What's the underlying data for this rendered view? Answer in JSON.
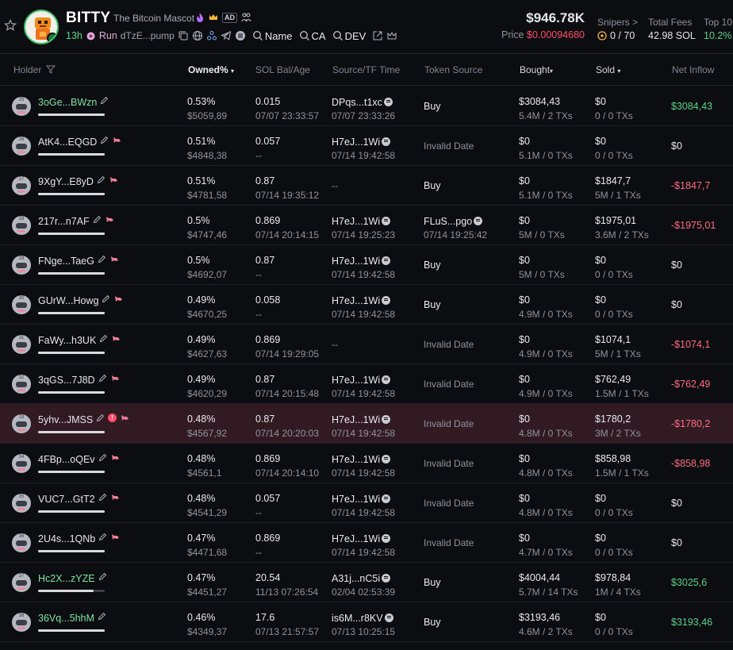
{
  "header": {
    "name": "BITTY",
    "full_name": "The Bitcoin Mascot",
    "badge_ad": "AD",
    "age": "13h",
    "run_label": "Run",
    "ca_short": "dTzE...pump",
    "search_name_label": "Name",
    "search_ca_label": "CA",
    "search_dev_label": "DEV",
    "market_cap": "$946.78K",
    "price_label": "Price",
    "price_value": "$0.00094680",
    "snipers_label": "Snipers >",
    "snipers_value": "0 / 70",
    "fees_label": "Total Fees",
    "fees_value": "42.98 SOL",
    "top10_label": "Top 10",
    "top10_value": "10.2%"
  },
  "columns": {
    "holder": "Holder",
    "owned": "Owned%",
    "sol_bal": "SOL Bal/Age",
    "source_tf": "Source/TF Time",
    "token_source": "Token Source",
    "bought": "Bought",
    "sold": "Sold",
    "net_inflow": "Net Inflow"
  },
  "colors": {
    "accent_green": "#59d38c",
    "accent_red": "#ff4d6a",
    "highlight_row": "#321a23"
  },
  "rows": [
    {
      "rank": "25",
      "holder": "3oGe...BWzn",
      "green": true,
      "fish": false,
      "warn": false,
      "owned_pct": "0.53%",
      "owned_usd": "$5059,89",
      "sol": "0.015",
      "age": "07/07 23:33:57",
      "src": "DPqs...t1xc",
      "src_time": "07/07 23:33:26",
      "tsrc": "Buy",
      "tsrc_time": "",
      "bought": "$3084,43",
      "bought_sub": "5.4M / 2 TXs",
      "sold": "$0",
      "sold_sub": "0 / 0 TXs",
      "net": "$3084,43",
      "net_cls": "pos",
      "fill": 1.0
    },
    {
      "rank": "26",
      "holder": "AtK4...EQGD",
      "green": false,
      "fish": true,
      "warn": false,
      "owned_pct": "0.51%",
      "owned_usd": "$4848,38",
      "sol": "0.057",
      "age": "--",
      "src": "H7eJ...1Wi",
      "src_time": "07/14 19:42:58",
      "tsrc": "Invalid Date",
      "tsrc_time": "",
      "bought": "$0",
      "bought_sub": "5.1M / 0 TXs",
      "sold": "$0",
      "sold_sub": "0 / 0 TXs",
      "net": "$0",
      "net_cls": "zero",
      "fill": 1.0
    },
    {
      "rank": "27",
      "holder": "9XgY...E8yD",
      "green": false,
      "fish": true,
      "warn": false,
      "owned_pct": "0.51%",
      "owned_usd": "$4781,58",
      "sol": "0.87",
      "age": "07/14 19:35:12",
      "src": "--",
      "src_time": "",
      "tsrc": "Buy",
      "tsrc_time": "",
      "bought": "$0",
      "bought_sub": "5.1M / 0 TXs",
      "sold": "$1847,7",
      "sold_sub": "5M / 1 TXs",
      "net": "-$1847,7",
      "net_cls": "neg",
      "fill": 1.0
    },
    {
      "rank": "28",
      "holder": "217r...n7AF",
      "green": false,
      "fish": true,
      "warn": false,
      "owned_pct": "0.5%",
      "owned_usd": "$4747,46",
      "sol": "0.869",
      "age": "07/14 20:14:15",
      "src": "H7eJ...1Wi",
      "src_time": "07/14 19:25:23",
      "tsrc": "FLuS...pgo",
      "tsrc_time": "07/14 19:25:42",
      "bought": "$0",
      "bought_sub": "5M / 0 TXs",
      "sold": "$1975,01",
      "sold_sub": "3.6M / 2 TXs",
      "net": "-$1975,01",
      "net_cls": "neg",
      "fill": 1.0
    },
    {
      "rank": "29",
      "holder": "FNge...TaeG",
      "green": false,
      "fish": true,
      "warn": false,
      "owned_pct": "0.5%",
      "owned_usd": "$4692,07",
      "sol": "0.87",
      "age": "--",
      "src": "H7eJ...1Wi",
      "src_time": "07/14 19:42:58",
      "tsrc": "Buy",
      "tsrc_time": "",
      "bought": "$0",
      "bought_sub": "5M / 0 TXs",
      "sold": "$0",
      "sold_sub": "0 / 0 TXs",
      "net": "$0",
      "net_cls": "zero",
      "fill": 1.0
    },
    {
      "rank": "30",
      "holder": "GUrW...Howg",
      "green": false,
      "fish": true,
      "warn": false,
      "owned_pct": "0.49%",
      "owned_usd": "$4670,25",
      "sol": "0.058",
      "age": "--",
      "src": "H7eJ...1Wi",
      "src_time": "07/14 19:42:58",
      "tsrc": "Buy",
      "tsrc_time": "",
      "bought": "$0",
      "bought_sub": "4.9M / 0 TXs",
      "sold": "$0",
      "sold_sub": "0 / 0 TXs",
      "net": "$0",
      "net_cls": "zero",
      "fill": 1.0
    },
    {
      "rank": "31",
      "holder": "FaWy...h3UK",
      "green": false,
      "fish": true,
      "warn": false,
      "owned_pct": "0.49%",
      "owned_usd": "$4627,63",
      "sol": "0.869",
      "age": "07/14 19:29:05",
      "src": "--",
      "src_time": "",
      "tsrc": "Invalid Date",
      "tsrc_time": "",
      "bought": "$0",
      "bought_sub": "4.9M / 0 TXs",
      "sold": "$1074,1",
      "sold_sub": "5M / 1 TXs",
      "net": "-$1074,1",
      "net_cls": "neg",
      "fill": 1.0
    },
    {
      "rank": "32",
      "holder": "3qGS...7J8D",
      "green": false,
      "fish": true,
      "warn": false,
      "owned_pct": "0.49%",
      "owned_usd": "$4620,29",
      "sol": "0.87",
      "age": "07/14 20:15:48",
      "src": "H7eJ...1Wi",
      "src_time": "07/14 19:42:58",
      "tsrc": "Invalid Date",
      "tsrc_time": "",
      "bought": "$0",
      "bought_sub": "4.9M / 0 TXs",
      "sold": "$762,49",
      "sold_sub": "1.5M / 1 TXs",
      "net": "-$762,49",
      "net_cls": "neg",
      "fill": 1.0
    },
    {
      "rank": "33",
      "holder": "5yhv...JMSS",
      "green": false,
      "fish": true,
      "warn": true,
      "owned_pct": "0.48%",
      "owned_usd": "$4567,92",
      "sol": "0.87",
      "age": "07/14 20:20:03",
      "src": "H7eJ...1Wi",
      "src_time": "07/14 19:42:58",
      "tsrc": "Invalid Date",
      "tsrc_time": "",
      "bought": "$0",
      "bought_sub": "4.8M / 0 TXs",
      "sold": "$1780,2",
      "sold_sub": "3M / 2 TXs",
      "net": "-$1780,2",
      "net_cls": "neg",
      "fill": 1.0,
      "highlight": true
    },
    {
      "rank": "34",
      "holder": "4FBp...oQEv",
      "green": false,
      "fish": true,
      "warn": false,
      "owned_pct": "0.48%",
      "owned_usd": "$4561,1",
      "sol": "0.869",
      "age": "07/14 20:14:10",
      "src": "H7eJ...1Wi",
      "src_time": "07/14 19:42:58",
      "tsrc": "Invalid Date",
      "tsrc_time": "",
      "bought": "$0",
      "bought_sub": "4.8M / 0 TXs",
      "sold": "$858,98",
      "sold_sub": "1.5M / 1 TXs",
      "net": "-$858,98",
      "net_cls": "neg",
      "fill": 1.0
    },
    {
      "rank": "35",
      "holder": "VUC7...GtT2",
      "green": false,
      "fish": true,
      "warn": false,
      "owned_pct": "0.48%",
      "owned_usd": "$4541,29",
      "sol": "0.057",
      "age": "--",
      "src": "H7eJ...1Wi",
      "src_time": "07/14 19:42:58",
      "tsrc": "Invalid Date",
      "tsrc_time": "",
      "bought": "$0",
      "bought_sub": "4.8M / 0 TXs",
      "sold": "$0",
      "sold_sub": "0 / 0 TXs",
      "net": "$0",
      "net_cls": "zero",
      "fill": 1.0
    },
    {
      "rank": "36",
      "holder": "2U4s...1QNb",
      "green": false,
      "fish": true,
      "warn": false,
      "owned_pct": "0.47%",
      "owned_usd": "$4471,68",
      "sol": "0.869",
      "age": "--",
      "src": "H7eJ...1Wi",
      "src_time": "07/14 19:42:58",
      "tsrc": "Invalid Date",
      "tsrc_time": "",
      "bought": "$0",
      "bought_sub": "4.7M / 0 TXs",
      "sold": "$0",
      "sold_sub": "0 / 0 TXs",
      "net": "$0",
      "net_cls": "zero",
      "fill": 1.0
    },
    {
      "rank": "37",
      "holder": "Hc2X...zYZE",
      "green": true,
      "fish": false,
      "warn": false,
      "owned_pct": "0.47%",
      "owned_usd": "$4451,27",
      "sol": "20.54",
      "age": "11/13 07:26:54",
      "src": "A31j...nC5i",
      "src_time": "02/04 02:53:39",
      "tsrc": "Buy",
      "tsrc_time": "",
      "bought": "$4004,44",
      "bought_sub": "5.7M / 14 TXs",
      "sold": "$978,84",
      "sold_sub": "1M / 4 TXs",
      "net": "$3025,6",
      "net_cls": "pos",
      "fill": 0.83
    },
    {
      "rank": "38",
      "holder": "36Vq...5hhM",
      "green": true,
      "fish": false,
      "warn": false,
      "owned_pct": "0.46%",
      "owned_usd": "$4349,37",
      "sol": "17.6",
      "age": "07/13 21:57:57",
      "src": "is6M...r8KV",
      "src_time": "07/13 10:25:15",
      "tsrc": "Buy",
      "tsrc_time": "",
      "bought": "$3193,46",
      "bought_sub": "4.6M / 2 TXs",
      "sold": "$0",
      "sold_sub": "0 / 0 TXs",
      "net": "$3193,46",
      "net_cls": "pos",
      "fill": 1.0
    }
  ]
}
